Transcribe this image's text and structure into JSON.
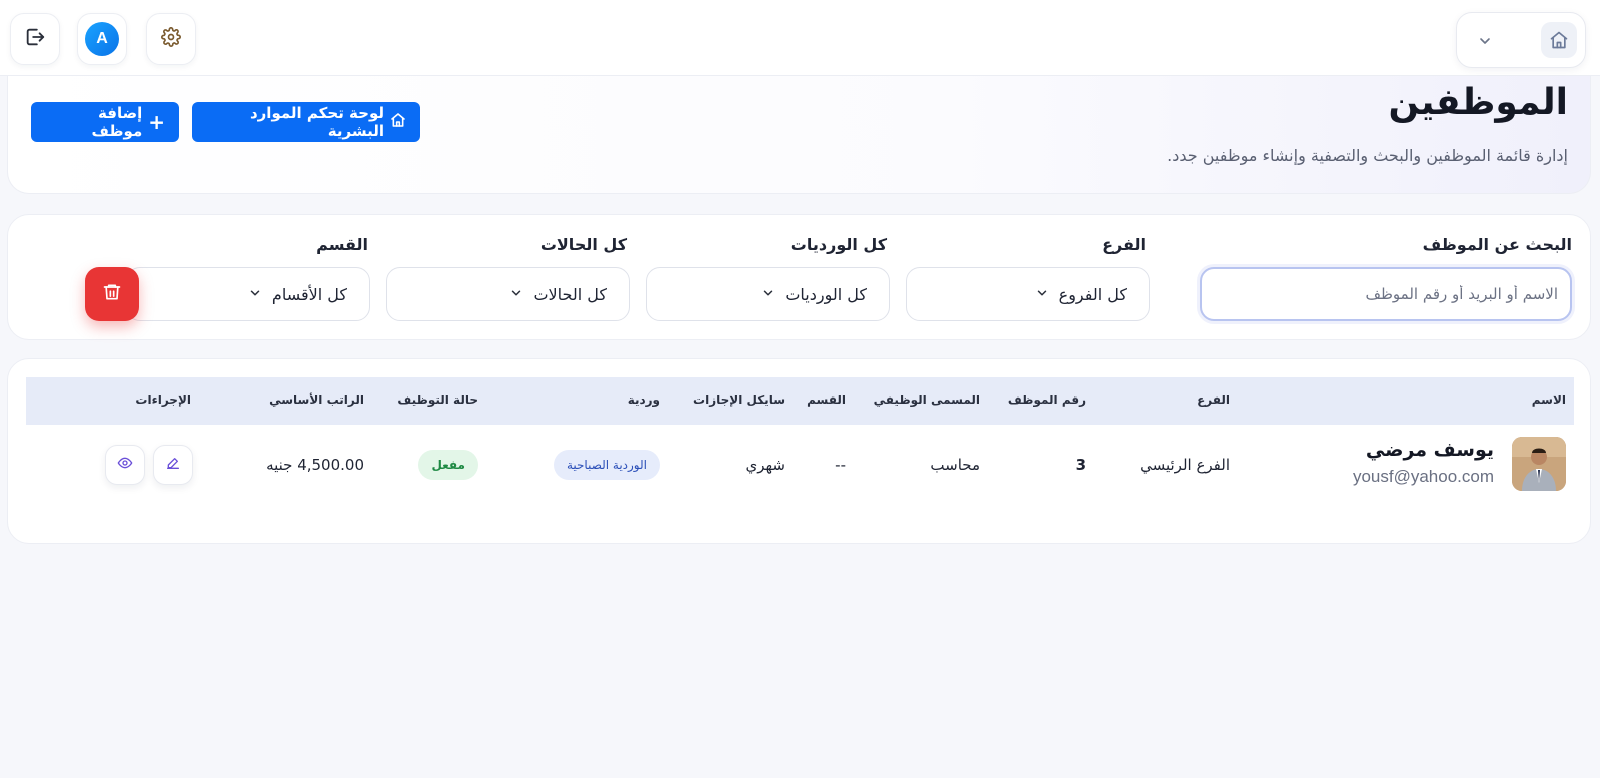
{
  "header": {
    "title": "الموظفين",
    "subtitle": "إدارة قائمة الموظفين والبحث والتصفية وإنشاء موظفين جدد.",
    "hr_dashboard_label": "لوحة تحكم الموارد البشرية",
    "add_employee_label": "إضافة موظف",
    "add_icon": "+"
  },
  "topbar": {
    "avatar_initial": "A",
    "icons": [
      "home-icon",
      "chevron-down-icon",
      "settings-icon",
      "logout-icon"
    ]
  },
  "filters": {
    "search_label": "البحث عن الموظف",
    "search_placeholder": "الاسم أو البريد أو رقم الموظف",
    "branch_label": "الفرع",
    "branch_value": "كل الفروع",
    "shift_label": "كل الورديات",
    "shift_value": "كل الورديات",
    "status_label": "كل الحالات",
    "status_value": "كل الحالات",
    "department_label": "القسم",
    "department_value": "كل الأقسام"
  },
  "table": {
    "headers": {
      "name": "الاسم",
      "branch": "الفرع",
      "employee_no": "رقم الموظف",
      "job_title": "المسمى الوظيفي",
      "department": "القسم",
      "leave_cycle": "سايكل الإجازات",
      "shift": "وردية",
      "employment_status": "حالة التوظيف",
      "base_salary": "الراتب الأساسي",
      "actions": "الإجراءات"
    },
    "rows": [
      {
        "name": "يوسف مرضي",
        "email": "yousf@yahoo.com",
        "branch": "الفرع الرئيسي",
        "employee_no": "3",
        "job_title": "محاسب",
        "department": "--",
        "leave_cycle": "شهري",
        "shift": "الوردية الصباحية",
        "employment_status": "مفعل",
        "base_salary": "4,500.00 جنيه"
      }
    ]
  },
  "colors": {
    "primary": "#0a6cf5",
    "danger": "#e83535",
    "table_header_bg": "#e6ebf8",
    "status_active_bg": "#e3f6e8",
    "status_active_text": "#1f8a44",
    "shift_badge_bg": "#e6ecfb",
    "shift_badge_text": "#2b4fb8"
  }
}
